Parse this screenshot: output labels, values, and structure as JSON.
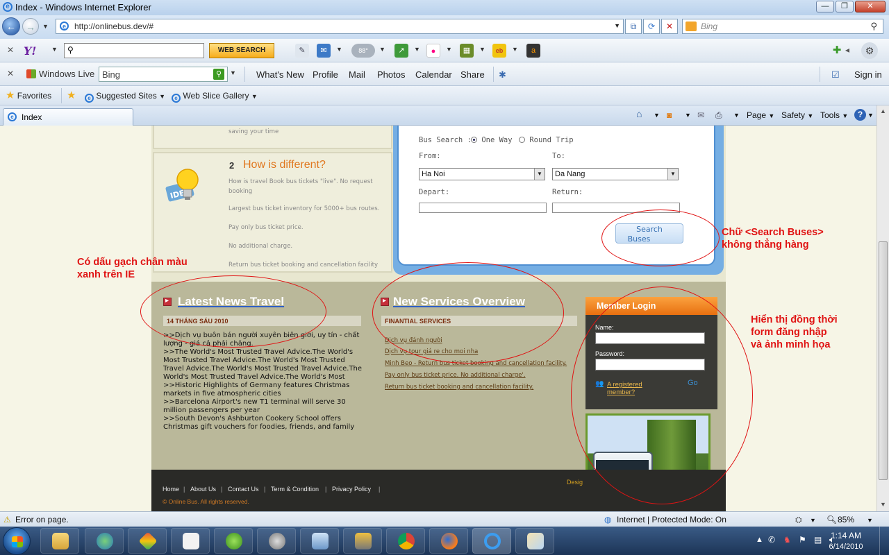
{
  "window": {
    "title": "Index - Windows Internet Explorer"
  },
  "address": {
    "url": "http://onlinebus.dev/#",
    "search_placeholder": "Bing"
  },
  "yahoo_toolbar": {
    "logo": "Y!",
    "search_button": "WEB SEARCH",
    "mail_badge": "88°"
  },
  "live_toolbar": {
    "brand": "Windows Live",
    "search_value": "Bing",
    "links": [
      "What's New",
      "Profile",
      "Mail",
      "Photos",
      "Calendar",
      "Share"
    ],
    "sign_in": "Sign in"
  },
  "favorites_bar": {
    "favorites": "Favorites",
    "suggested": "Suggested Sites",
    "webslice": "Web Slice Gallery"
  },
  "tab": {
    "label": "Index"
  },
  "command_bar": {
    "page": "Page",
    "safety": "Safety",
    "tools": "Tools"
  },
  "page": {
    "top_panel_text": "saving your time",
    "how_different": {
      "number": "2",
      "title": "How is different?",
      "lines": [
        "How is travel Book bus tickets \"live\". No request booking",
        "Largest bus ticket inventory for 5000+ bus routes.",
        "Pay only bus ticket price.",
        "No additional charge.",
        "Return bus ticket booking and cancellation facility"
      ]
    },
    "bus_search": {
      "label": "Bus Search :",
      "one_way": "One Way",
      "round_trip": "Round Trip",
      "from_label": "From:",
      "to_label": "To:",
      "from_value": "Ha Noi",
      "to_value": "Da Nang",
      "depart_label": "Depart:",
      "return_label": "Return:",
      "button_line1": "Search",
      "button_line2": "Buses"
    },
    "news": {
      "title": "Latest News Travel",
      "date_bar": "14 THÁNG SÁU 2010",
      "text": ">>Dịch vụ buôn bán người xuyên biên giới, uy tín - chất lượng - giá cả phải chăng.\n>>The World's Most Trusted Travel Advice.The World's Most Trusted Travel Advice.The World's Most Trusted Travel Advice.The World's Most Trusted Travel Advice.The World's Most Trusted Travel Advice.The World's Most\n>>Historic Highlights of Germany features Christmas markets in five atmospheric cities\n>>Barcelona Airport's new T1 terminal will serve 30 million passengers per year\n>>South Devon's Ashburton Cookery School offers Christmas gift vouchers for foodies, friends, and family"
    },
    "services": {
      "title": "New Services Overview",
      "bar": "FINANTIAL SERVICES",
      "links": [
        "Dịch vụ đánh người",
        "Dịch vụ tour giá re cho moi nha",
        "Minh Beo - Return bus ticket booking and cancellation facility.",
        "Pay only bus ticket price. No additional charge'.",
        "Return bus ticket booking and cancellation facility."
      ]
    },
    "login": {
      "title": "Member Login",
      "name_label": "Name:",
      "password_label": "Password:",
      "registered_line1": "A registered",
      "registered_line2": "member?",
      "go": "Go"
    },
    "footer": {
      "links": [
        "Home",
        "About Us",
        "Contact Us",
        "Term & Condition",
        "Privacy Policy"
      ],
      "copyright": "© Online Bus. All rights reserved.",
      "design": "Desig"
    }
  },
  "annotations": {
    "underline_note_1": "Có dấu gạch chân màu",
    "underline_note_2": "xanh trên IE",
    "button_note_1": "Chữ <Search Buses>",
    "button_note_2": "không thẳng hàng",
    "login_note_1": "Hiển thị đồng thời",
    "login_note_2": "form đăng nhập",
    "login_note_3": "và ảnh minh họa"
  },
  "status_bar": {
    "error": "Error on page.",
    "zone": "Internet | Protected Mode: On",
    "zoom": "85%"
  },
  "taskbar": {
    "time": "1:14 AM",
    "date": "6/14/2010"
  }
}
